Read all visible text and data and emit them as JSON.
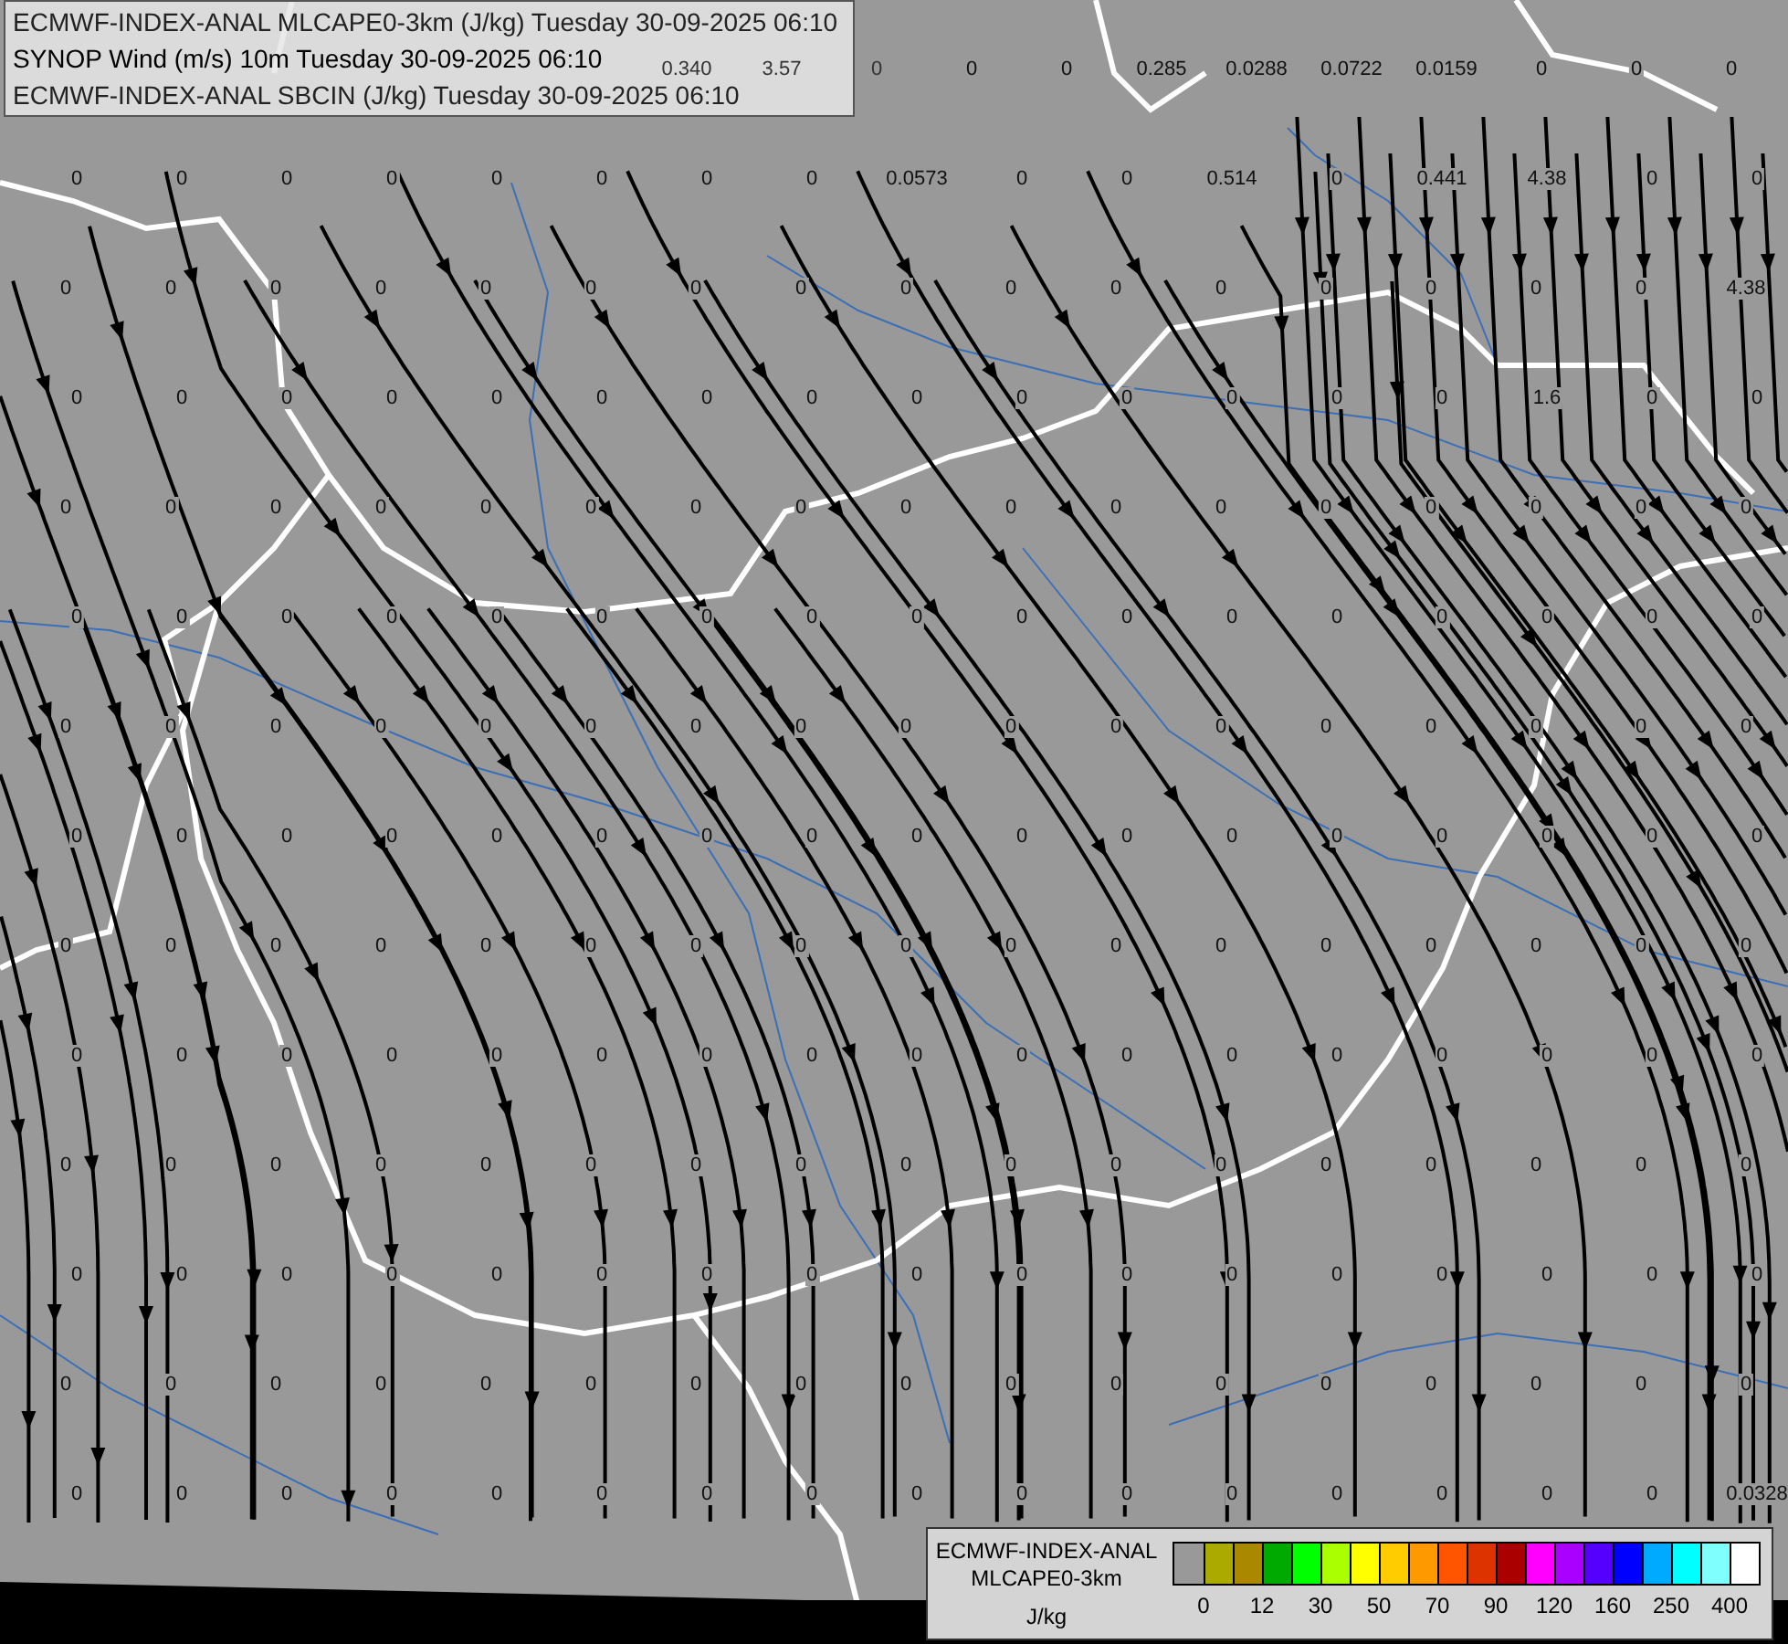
{
  "header": {
    "lines": [
      "ECMWF-INDEX-ANAL MLCAPE0-3km (J/kg) Tuesday 30-09-2025 06:10",
      "SYNOP Wind (m/s) 10m Tuesday 30-09-2025 06:10",
      "ECMWF-INDEX-ANAL SBCIN (J/kg) Tuesday 30-09-2025 06:10"
    ]
  },
  "map": {
    "value_rows": [
      [
        "0.340",
        "3.57",
        "0",
        "0",
        "0",
        "0.285",
        "0.0288",
        "0.0722",
        "0.0159",
        "0",
        "0",
        "0"
      ],
      [
        "0",
        "0",
        "0",
        "0",
        "0",
        "0",
        "0",
        "0",
        "0.0573",
        "0",
        "0",
        "0.514",
        "0",
        "0.441",
        "4.38",
        "0",
        "0"
      ],
      [
        "0",
        "0",
        "0",
        "0",
        "0",
        "0",
        "0",
        "0",
        "0",
        "0",
        "0",
        "0",
        "0",
        "0",
        "0",
        "0",
        "4.38"
      ],
      [
        "0",
        "0",
        "0",
        "0",
        "0",
        "0",
        "0",
        "0",
        "0",
        "0",
        "0",
        "0",
        "0",
        "0",
        "1.6",
        "0",
        "0"
      ],
      [
        "0",
        "0",
        "0",
        "0",
        "0",
        "0",
        "0",
        "0",
        "0",
        "0",
        "0",
        "0",
        "0",
        "0",
        "0",
        "0",
        "0"
      ],
      [
        "0",
        "0",
        "0",
        "0",
        "0",
        "0",
        "0",
        "0",
        "0",
        "0",
        "0",
        "0",
        "0",
        "0",
        "0",
        "0",
        "0"
      ],
      [
        "0",
        "0",
        "0",
        "0",
        "0",
        "0",
        "0",
        "0",
        "0",
        "0",
        "0",
        "0",
        "0",
        "0",
        "0",
        "0",
        "0"
      ],
      [
        "0",
        "0",
        "0",
        "0",
        "0",
        "0",
        "0",
        "0",
        "0",
        "0",
        "0",
        "0",
        "0",
        "0",
        "0",
        "0",
        "0"
      ],
      [
        "0",
        "0",
        "0",
        "0",
        "0",
        "0",
        "0",
        "0",
        "0",
        "0",
        "0",
        "0",
        "0",
        "0",
        "0",
        "0",
        "0"
      ],
      [
        "0",
        "0",
        "0",
        "0",
        "0",
        "0",
        "0",
        "0",
        "0",
        "0",
        "0",
        "0",
        "0",
        "0",
        "0",
        "0",
        "0"
      ],
      [
        "0",
        "0",
        "0",
        "0",
        "0",
        "0",
        "0",
        "0",
        "0",
        "0",
        "0",
        "0",
        "0",
        "0",
        "0",
        "0",
        "0"
      ],
      [
        "0",
        "0",
        "0",
        "0",
        "0",
        "0",
        "0",
        "0",
        "0",
        "0",
        "0",
        "0",
        "0",
        "0",
        "0",
        "0",
        "0"
      ],
      [
        "0",
        "0",
        "0",
        "0",
        "0",
        "0",
        "0",
        "0",
        "0",
        "0",
        "0",
        "0",
        "0",
        "0",
        "0",
        "0",
        "0"
      ],
      [
        "0",
        "0",
        "0",
        "0",
        "0",
        "0",
        "0",
        "0",
        "0",
        "0",
        "0",
        "0",
        "0",
        "0",
        "0",
        "0",
        "0.0328"
      ]
    ]
  },
  "legend": {
    "title_lines": [
      "ECMWF-INDEX-ANAL",
      "MLCAPE0-3km",
      "J/kg"
    ],
    "swatches": [
      {
        "color": "#999999"
      },
      {
        "color": "#aaaa00"
      },
      {
        "color": "#aa8800"
      },
      {
        "color": "#00aa00"
      },
      {
        "color": "#00ff00"
      },
      {
        "color": "#aaff00"
      },
      {
        "color": "#ffff00"
      },
      {
        "color": "#ffcc00"
      },
      {
        "color": "#ff9900"
      },
      {
        "color": "#ff5500"
      },
      {
        "color": "#dd3300"
      },
      {
        "color": "#aa0000"
      },
      {
        "color": "#ff00ff"
      },
      {
        "color": "#aa00ff"
      },
      {
        "color": "#5500ff"
      },
      {
        "color": "#0000ff"
      },
      {
        "color": "#00aaff"
      },
      {
        "color": "#00ffff"
      },
      {
        "color": "#80ffff"
      },
      {
        "color": "#ffffff"
      }
    ],
    "ticks": [
      "0",
      "12",
      "30",
      "50",
      "70",
      "90",
      "120",
      "160",
      "250",
      "400"
    ]
  }
}
